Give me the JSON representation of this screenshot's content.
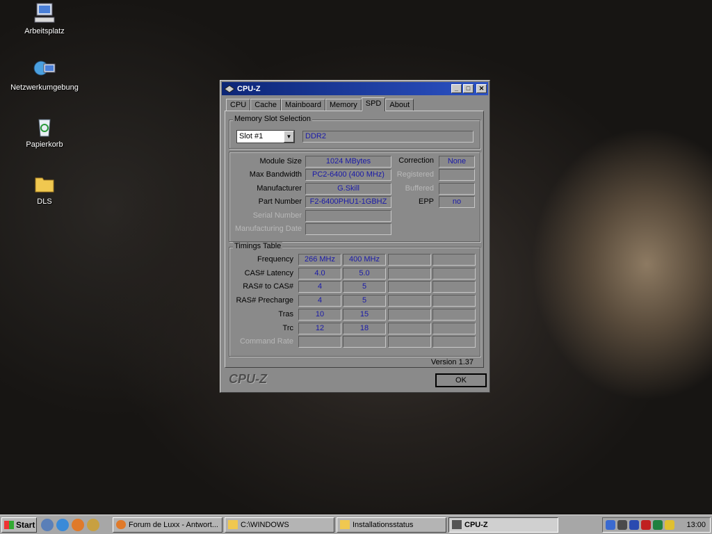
{
  "desktop": {
    "icons": [
      {
        "label": "Arbeitsplatz"
      },
      {
        "label": "Netzwerkumgebung"
      },
      {
        "label": "Papierkorb"
      },
      {
        "label": "DLS"
      }
    ]
  },
  "window": {
    "title": "CPU-Z",
    "controls": {
      "minimize": "_",
      "maximize": "□",
      "close": "✕"
    },
    "tabs": [
      "CPU",
      "Cache",
      "Mainboard",
      "Memory",
      "SPD",
      "About"
    ],
    "active_tab": "SPD",
    "slot_section": {
      "label": "Memory Slot Selection",
      "slot_value": "Slot #1",
      "type": "DDR2"
    },
    "module": {
      "module_size_label": "Module Size",
      "module_size": "1024 MBytes",
      "max_bandwidth_label": "Max Bandwidth",
      "max_bandwidth": "PC2-6400 (400 MHz)",
      "manufacturer_label": "Manufacturer",
      "manufacturer": "G.Skill",
      "part_number_label": "Part Number",
      "part_number": "F2-6400PHU1-1GBHZ",
      "serial_number_label": "Serial Number",
      "serial_number": "",
      "manufacturing_date_label": "Manufacturing Date",
      "manufacturing_date": "",
      "correction_label": "Correction",
      "correction": "None",
      "registered_label": "Registered",
      "registered": "",
      "buffered_label": "Buffered",
      "buffered": "",
      "epp_label": "EPP",
      "epp": "no"
    },
    "timings": {
      "label": "Timings Table",
      "rows": [
        {
          "label": "Frequency",
          "values": [
            "266 MHz",
            "400 MHz",
            "",
            ""
          ]
        },
        {
          "label": "CAS# Latency",
          "values": [
            "4.0",
            "5.0",
            "",
            ""
          ]
        },
        {
          "label": "RAS# to CAS#",
          "values": [
            "4",
            "5",
            "",
            ""
          ]
        },
        {
          "label": "RAS# Precharge",
          "values": [
            "4",
            "5",
            "",
            ""
          ]
        },
        {
          "label": "Tras",
          "values": [
            "10",
            "15",
            "",
            ""
          ]
        },
        {
          "label": "Trc",
          "values": [
            "12",
            "18",
            "",
            ""
          ]
        },
        {
          "label": "Command Rate",
          "values": [
            "",
            "",
            "",
            ""
          ]
        }
      ]
    },
    "version": "Version 1.37",
    "brand": "CPU-Z",
    "ok_label": "OK"
  },
  "taskbar": {
    "start_label": "Start",
    "tasks": [
      {
        "label": "Forum de Luxx - Antwort..."
      },
      {
        "label": "C:\\WINDOWS"
      },
      {
        "label": "Installationsstatus"
      },
      {
        "label": "CPU-Z"
      }
    ],
    "clock": "13:00"
  },
  "colors": {
    "window_bg": "#8a8a8a",
    "value_text": "#1a1aa8",
    "titlebar": "#0c2576"
  }
}
